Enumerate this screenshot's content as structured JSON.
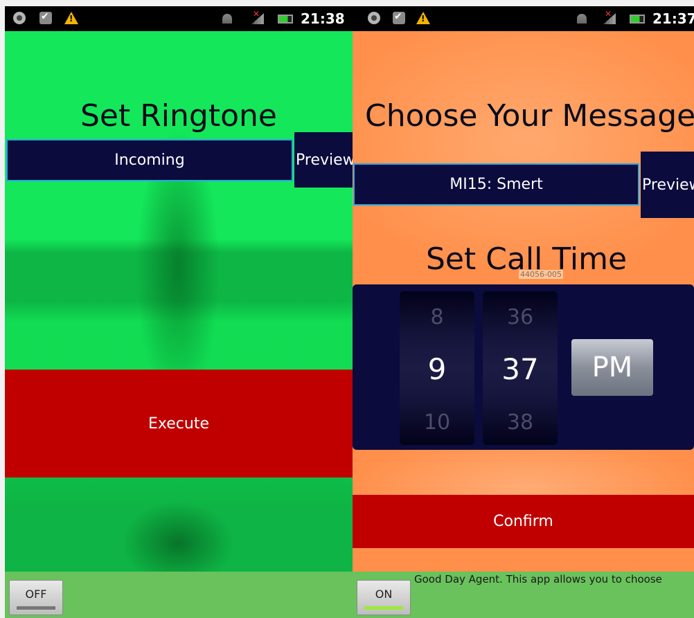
{
  "colors": {
    "left_background": "#14e85a",
    "right_background": "#ff8f4a",
    "navy": "#0b0b3e",
    "red": "#c00000",
    "select_border": "#2aa7e4",
    "footer": "#6ac25c"
  },
  "left_screen": {
    "status_bar": {
      "icons": [
        "notification-circle-icon",
        "checkbox-icon",
        "warning-icon",
        "wifi-icon",
        "signal-icon",
        "battery-icon"
      ],
      "time": "21:38"
    },
    "title": "Set Ringtone",
    "ringtone_select": {
      "value": "Incoming"
    },
    "preview_label": "Preview",
    "execute_label": "Execute",
    "toggle": {
      "label": "OFF",
      "state": "off"
    }
  },
  "right_screen": {
    "status_bar": {
      "icons": [
        "notification-circle-icon",
        "checkbox-icon",
        "warning-icon",
        "wifi-icon",
        "signal-icon",
        "battery-icon"
      ],
      "time": "21:37"
    },
    "title": "Choose Your Message",
    "message_select": {
      "value": "MI15: Smert"
    },
    "preview_label": "Preview",
    "subtitle": "Set Call Time",
    "serial_label": "44056-005",
    "time_picker": {
      "hour": {
        "above": "8",
        "selected": "9",
        "below": "10"
      },
      "minute": {
        "above": "36",
        "selected": "37",
        "below": "38"
      },
      "ampm": "PM"
    },
    "confirm_label": "Confirm",
    "toggle": {
      "label": "ON",
      "state": "on"
    },
    "intro_text": "Good Day Agent. This app allows you to choose"
  }
}
